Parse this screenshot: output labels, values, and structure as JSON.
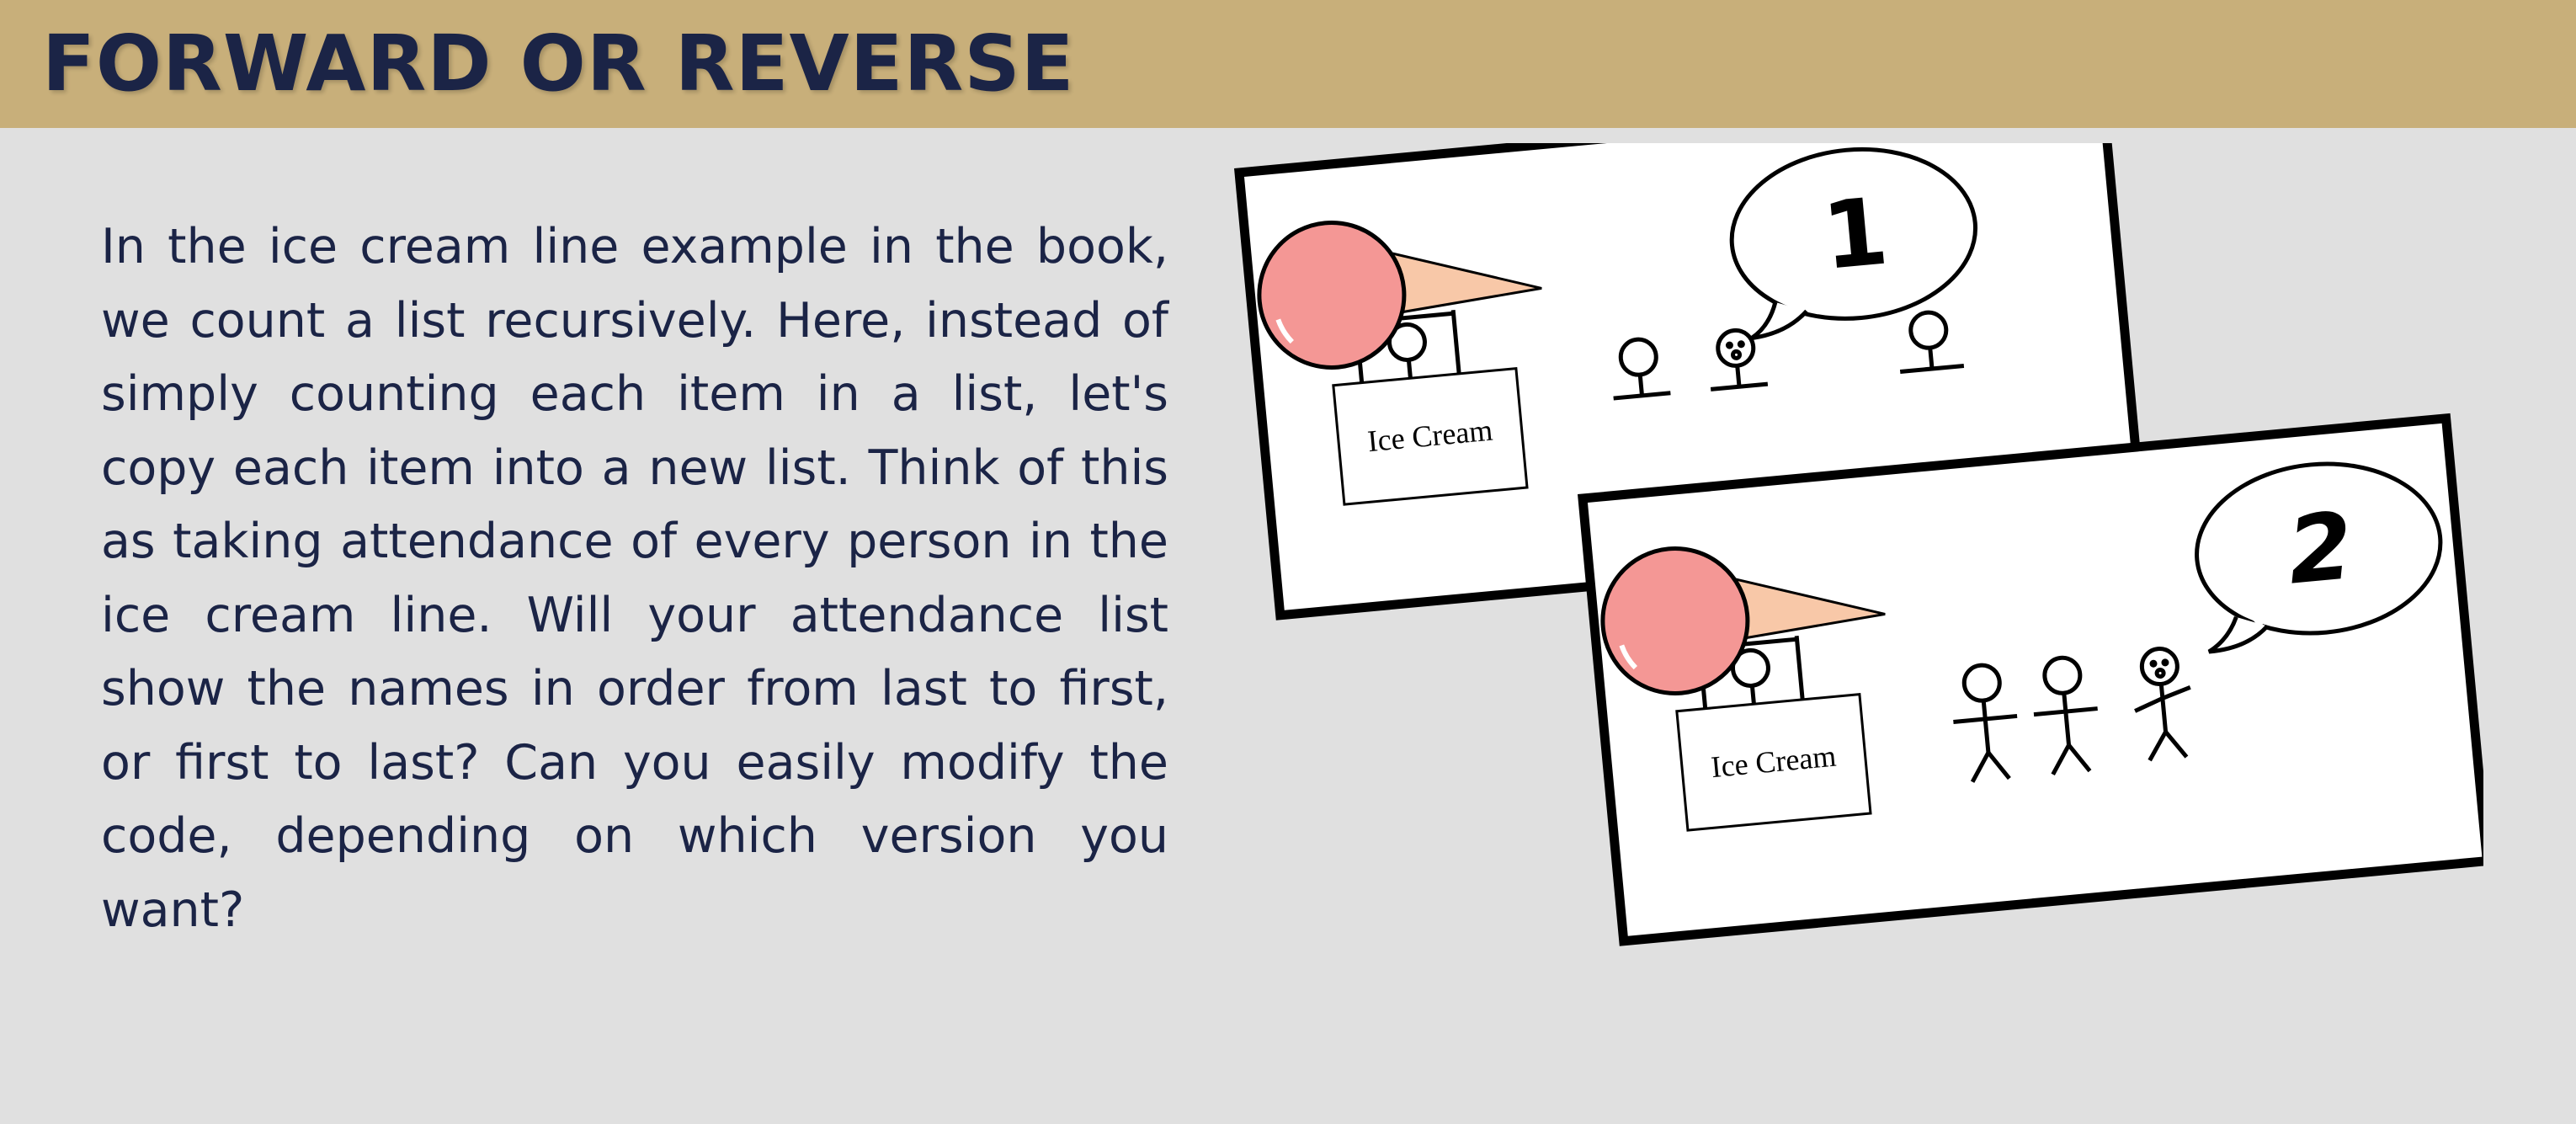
{
  "slide": {
    "title": "FORWARD OR REVERSE",
    "body": "In the ice cream line example in the book, we count a list recursively. Here, instead of simply counting each item in a list, let's copy each item into a new list. Think of this as taking attendance of every person in the ice cream line. Will your attendance list show the names in order from last to first, or first to last? Can you easily modify the code, depending on which version you want?"
  },
  "illustration": {
    "panels": [
      {
        "sign": "Ice Cream",
        "bubble": "1"
      },
      {
        "sign": "Ice Cream",
        "bubble": "2"
      }
    ]
  },
  "colors": {
    "title_bar": "#c8af7a",
    "title_text": "#1b2446",
    "background": "#e0e0e0",
    "scoop": "#f49795",
    "cone": "#f8c8a8"
  }
}
